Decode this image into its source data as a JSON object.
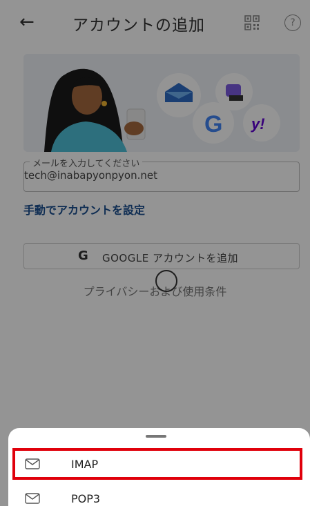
{
  "header": {
    "back_icon": "arrow-left-icon",
    "title": "アカウントの追加",
    "qr_icon": "qr-code-icon",
    "help_icon": "?"
  },
  "email": {
    "label": "メールを入力してください",
    "value": "tech@inabapyonpyon.net"
  },
  "manual_link": "手動でアカウントを設定",
  "google_button": {
    "logo": "G",
    "label": "GOOGLE アカウントを追加"
  },
  "privacy_link": "プライバシーおよび使用条件",
  "sheet": {
    "options": [
      {
        "label": "IMAP",
        "icon": "mail-icon"
      },
      {
        "label": "POP3",
        "icon": "mail-icon"
      }
    ]
  },
  "colors": {
    "highlight": "#e0000b",
    "link": "#1a4f8f"
  }
}
